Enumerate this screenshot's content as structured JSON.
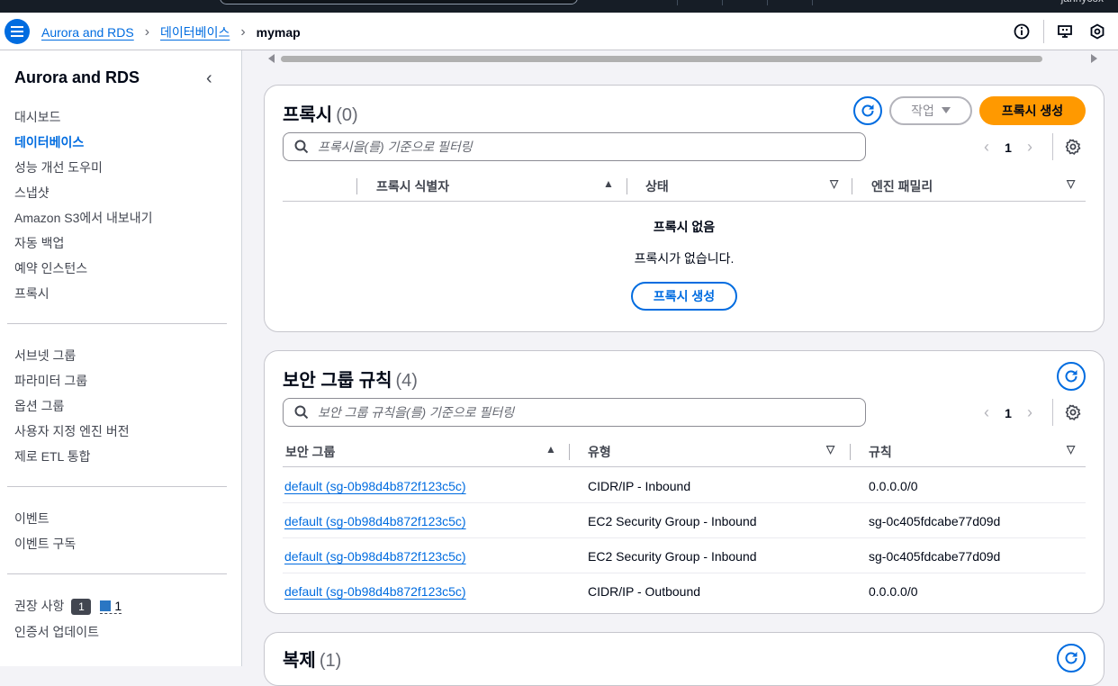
{
  "topbar": {
    "user": "jannycox"
  },
  "breadcrumb": {
    "items": [
      "Aurora and RDS",
      "데이터베이스"
    ],
    "current": "mymap"
  },
  "sidebar": {
    "title": "Aurora and RDS",
    "group1": [
      "대시보드",
      "데이터베이스",
      "성능 개선 도우미",
      "스냅샷",
      "Amazon S3에서 내보내기",
      "자동 백업",
      "예약 인스턴스",
      "프록시"
    ],
    "group2": [
      "서브넷 그룹",
      "파라미터 그룹",
      "옵션 그룹",
      "사용자 지정 엔진 버전",
      "제로 ETL 통합"
    ],
    "group3": [
      "이벤트",
      "이벤트 구독"
    ],
    "recommendations": {
      "label": "권장 사항",
      "count": "1",
      "info_count": "1"
    },
    "cert_update": "인증서 업데이트"
  },
  "proxy": {
    "title": "프록시",
    "count": "(0)",
    "action_label": "작업",
    "create_label": "프록시 생성",
    "filter_placeholder": "프록시을(를) 기준으로 필터링",
    "page": "1",
    "columns": [
      "프록시 식별자",
      "상태",
      "엔진 패밀리"
    ],
    "empty_title": "프록시 없음",
    "empty_text": "프록시가 없습니다.",
    "empty_button": "프록시 생성"
  },
  "security": {
    "title": "보안 그룹 규칙",
    "count": "(4)",
    "filter_placeholder": "보안 그룹 규칙을(를) 기준으로 필터링",
    "page": "1",
    "columns": [
      "보안 그룹",
      "유형",
      "규칙"
    ],
    "rows": [
      {
        "group": "default (sg-0b98d4b872f123c5c)",
        "type": "CIDR/IP - Inbound",
        "rule": "0.0.0.0/0"
      },
      {
        "group": "default (sg-0b98d4b872f123c5c)",
        "type": "EC2 Security Group - Inbound",
        "rule": "sg-0c405fdcabe77d09d"
      },
      {
        "group": "default (sg-0b98d4b872f123c5c)",
        "type": "EC2 Security Group - Inbound",
        "rule": "sg-0c405fdcabe77d09d"
      },
      {
        "group": "default (sg-0b98d4b872f123c5c)",
        "type": "CIDR/IP - Outbound",
        "rule": "0.0.0.0/0"
      }
    ]
  },
  "replication": {
    "title": "복제",
    "count": "(1)"
  },
  "colors": {
    "link": "#006ce0",
    "primary": "#ff9900",
    "topbar": "#161d26"
  }
}
